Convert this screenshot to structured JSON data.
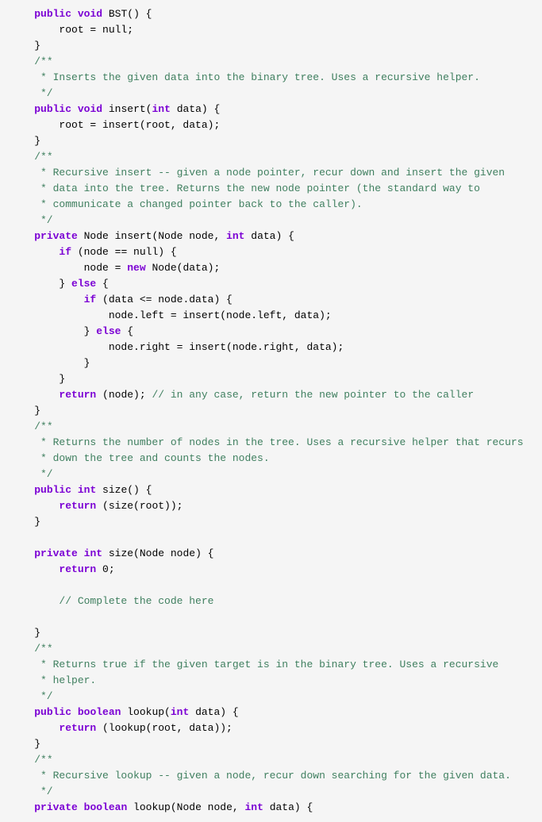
{
  "code": {
    "lines": [
      {
        "tokens": [
          {
            "text": "    ",
            "class": "plain"
          },
          {
            "text": "public",
            "class": "kw"
          },
          {
            "text": " ",
            "class": "plain"
          },
          {
            "text": "void",
            "class": "kw"
          },
          {
            "text": " BST() {",
            "class": "plain"
          }
        ]
      },
      {
        "tokens": [
          {
            "text": "        root = null;",
            "class": "plain"
          }
        ]
      },
      {
        "tokens": [
          {
            "text": "    }",
            "class": "plain"
          }
        ]
      },
      {
        "tokens": [
          {
            "text": "    ",
            "class": "plain"
          },
          {
            "text": "/**",
            "class": "cm"
          }
        ]
      },
      {
        "tokens": [
          {
            "text": "     * Inserts the given data into the binary tree. Uses a recursive helper.",
            "class": "cm"
          }
        ]
      },
      {
        "tokens": [
          {
            "text": "     */",
            "class": "cm"
          }
        ]
      },
      {
        "tokens": [
          {
            "text": "    ",
            "class": "plain"
          },
          {
            "text": "public",
            "class": "kw"
          },
          {
            "text": " ",
            "class": "plain"
          },
          {
            "text": "void",
            "class": "kw"
          },
          {
            "text": " insert(",
            "class": "plain"
          },
          {
            "text": "int",
            "class": "kw"
          },
          {
            "text": " data) {",
            "class": "plain"
          }
        ]
      },
      {
        "tokens": [
          {
            "text": "        root = insert(root, data);",
            "class": "plain"
          }
        ]
      },
      {
        "tokens": [
          {
            "text": "    }",
            "class": "plain"
          }
        ]
      },
      {
        "tokens": [
          {
            "text": "    ",
            "class": "plain"
          },
          {
            "text": "/**",
            "class": "cm"
          }
        ]
      },
      {
        "tokens": [
          {
            "text": "     * Recursive insert -- given a node pointer, recur down and insert the given",
            "class": "cm"
          }
        ]
      },
      {
        "tokens": [
          {
            "text": "     * data into the tree. Returns the new node pointer (the standard way to",
            "class": "cm"
          }
        ]
      },
      {
        "tokens": [
          {
            "text": "     * communicate a changed pointer back to the caller).",
            "class": "cm"
          }
        ]
      },
      {
        "tokens": [
          {
            "text": "     */",
            "class": "cm"
          }
        ]
      },
      {
        "tokens": [
          {
            "text": "    ",
            "class": "plain"
          },
          {
            "text": "private",
            "class": "kw"
          },
          {
            "text": " Node insert(Node node, ",
            "class": "plain"
          },
          {
            "text": "int",
            "class": "kw"
          },
          {
            "text": " data) {",
            "class": "plain"
          }
        ]
      },
      {
        "tokens": [
          {
            "text": "        ",
            "class": "plain"
          },
          {
            "text": "if",
            "class": "kw"
          },
          {
            "text": " (node == null) {",
            "class": "plain"
          }
        ]
      },
      {
        "tokens": [
          {
            "text": "            node = ",
            "class": "plain"
          },
          {
            "text": "new",
            "class": "kw"
          },
          {
            "text": " Node(data);",
            "class": "plain"
          }
        ]
      },
      {
        "tokens": [
          {
            "text": "        } ",
            "class": "plain"
          },
          {
            "text": "else",
            "class": "kw"
          },
          {
            "text": " {",
            "class": "plain"
          }
        ]
      },
      {
        "tokens": [
          {
            "text": "            ",
            "class": "plain"
          },
          {
            "text": "if",
            "class": "kw"
          },
          {
            "text": " (data <= node.data) {",
            "class": "plain"
          }
        ]
      },
      {
        "tokens": [
          {
            "text": "                node.left = insert(node.left, data);",
            "class": "plain"
          }
        ]
      },
      {
        "tokens": [
          {
            "text": "            } ",
            "class": "plain"
          },
          {
            "text": "else",
            "class": "kw"
          },
          {
            "text": " {",
            "class": "plain"
          }
        ]
      },
      {
        "tokens": [
          {
            "text": "                node.right = insert(node.right, data);",
            "class": "plain"
          }
        ]
      },
      {
        "tokens": [
          {
            "text": "            }",
            "class": "plain"
          }
        ]
      },
      {
        "tokens": [
          {
            "text": "        }",
            "class": "plain"
          }
        ]
      },
      {
        "tokens": [
          {
            "text": "        ",
            "class": "plain"
          },
          {
            "text": "return",
            "class": "kw"
          },
          {
            "text": " (node); ",
            "class": "plain"
          },
          {
            "text": "// in any case, return the new pointer to the caller",
            "class": "cm"
          }
        ]
      },
      {
        "tokens": [
          {
            "text": "    }",
            "class": "plain"
          }
        ]
      },
      {
        "tokens": [
          {
            "text": "    ",
            "class": "plain"
          },
          {
            "text": "/**",
            "class": "cm"
          }
        ]
      },
      {
        "tokens": [
          {
            "text": "     * Returns the number of nodes in the tree. Uses a recursive helper that recurs",
            "class": "cm"
          }
        ]
      },
      {
        "tokens": [
          {
            "text": "     * down the tree and counts the nodes.",
            "class": "cm"
          }
        ]
      },
      {
        "tokens": [
          {
            "text": "     */",
            "class": "cm"
          }
        ]
      },
      {
        "tokens": [
          {
            "text": "    ",
            "class": "plain"
          },
          {
            "text": "public",
            "class": "kw"
          },
          {
            "text": " ",
            "class": "plain"
          },
          {
            "text": "int",
            "class": "kw"
          },
          {
            "text": " size() {",
            "class": "plain"
          }
        ]
      },
      {
        "tokens": [
          {
            "text": "        ",
            "class": "plain"
          },
          {
            "text": "return",
            "class": "kw"
          },
          {
            "text": " (size(root));",
            "class": "plain"
          }
        ]
      },
      {
        "tokens": [
          {
            "text": "    }",
            "class": "plain"
          }
        ]
      },
      {
        "tokens": [
          {
            "text": "",
            "class": "plain"
          }
        ]
      },
      {
        "tokens": [
          {
            "text": "    ",
            "class": "plain"
          },
          {
            "text": "private",
            "class": "kw"
          },
          {
            "text": " ",
            "class": "plain"
          },
          {
            "text": "int",
            "class": "kw"
          },
          {
            "text": " size(Node node) {",
            "class": "plain"
          }
        ]
      },
      {
        "tokens": [
          {
            "text": "        ",
            "class": "plain"
          },
          {
            "text": "return",
            "class": "kw"
          },
          {
            "text": " 0;",
            "class": "plain"
          }
        ]
      },
      {
        "tokens": [
          {
            "text": "",
            "class": "plain"
          }
        ]
      },
      {
        "tokens": [
          {
            "text": "        ",
            "class": "plain"
          },
          {
            "text": "// Complete the code here",
            "class": "cm"
          }
        ]
      },
      {
        "tokens": [
          {
            "text": "",
            "class": "plain"
          }
        ]
      },
      {
        "tokens": [
          {
            "text": "    }",
            "class": "plain"
          }
        ]
      },
      {
        "tokens": [
          {
            "text": "    ",
            "class": "plain"
          },
          {
            "text": "/**",
            "class": "cm"
          }
        ]
      },
      {
        "tokens": [
          {
            "text": "     * Returns true if the given target is in the binary tree. Uses a recursive",
            "class": "cm"
          }
        ]
      },
      {
        "tokens": [
          {
            "text": "     * helper.",
            "class": "cm"
          }
        ]
      },
      {
        "tokens": [
          {
            "text": "     */",
            "class": "cm"
          }
        ]
      },
      {
        "tokens": [
          {
            "text": "    ",
            "class": "plain"
          },
          {
            "text": "public",
            "class": "kw"
          },
          {
            "text": " ",
            "class": "plain"
          },
          {
            "text": "boolean",
            "class": "kw"
          },
          {
            "text": " lookup(",
            "class": "plain"
          },
          {
            "text": "int",
            "class": "kw"
          },
          {
            "text": " data) {",
            "class": "plain"
          }
        ]
      },
      {
        "tokens": [
          {
            "text": "        ",
            "class": "plain"
          },
          {
            "text": "return",
            "class": "kw"
          },
          {
            "text": " (lookup(root, data));",
            "class": "plain"
          }
        ]
      },
      {
        "tokens": [
          {
            "text": "    }",
            "class": "plain"
          }
        ]
      },
      {
        "tokens": [
          {
            "text": "    ",
            "class": "plain"
          },
          {
            "text": "/**",
            "class": "cm"
          }
        ]
      },
      {
        "tokens": [
          {
            "text": "     * Recursive lookup -- given a node, recur down searching for the given data.",
            "class": "cm"
          }
        ]
      },
      {
        "tokens": [
          {
            "text": "     */",
            "class": "cm"
          }
        ]
      },
      {
        "tokens": [
          {
            "text": "    ",
            "class": "plain"
          },
          {
            "text": "private",
            "class": "kw"
          },
          {
            "text": " ",
            "class": "plain"
          },
          {
            "text": "boolean",
            "class": "kw"
          },
          {
            "text": " lookup(Node node, ",
            "class": "plain"
          },
          {
            "text": "int",
            "class": "kw"
          },
          {
            "text": " data) {",
            "class": "plain"
          }
        ]
      }
    ]
  }
}
